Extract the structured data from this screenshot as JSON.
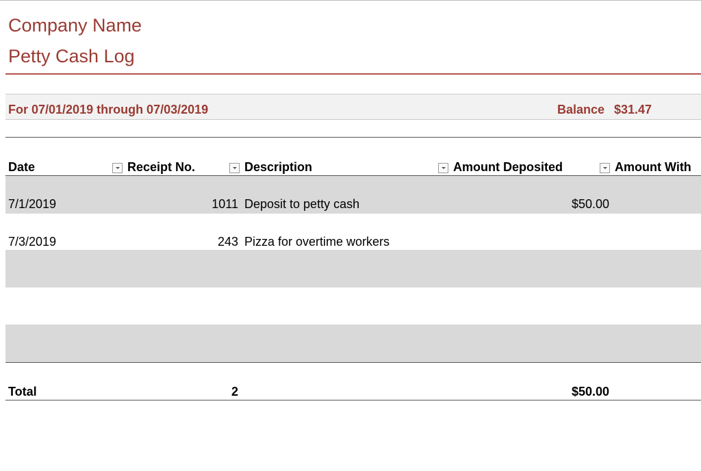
{
  "header": {
    "company_name": "Company Name",
    "log_title": "Petty Cash Log"
  },
  "period": {
    "text": "For 07/01/2019 through 07/03/2019",
    "balance_label": "Balance",
    "balance_value": "$31.47"
  },
  "columns": [
    {
      "label": "Date"
    },
    {
      "label": "Receipt No."
    },
    {
      "label": "Description"
    },
    {
      "label": "Amount Deposited"
    },
    {
      "label": "Amount With"
    }
  ],
  "rows": [
    {
      "date": "7/1/2019",
      "receipt": "1011",
      "description": "Deposit to petty cash",
      "deposited": "$50.00"
    },
    {
      "date": "7/3/2019",
      "receipt": "243",
      "description": "Pizza for overtime workers",
      "deposited": ""
    },
    {
      "date": "",
      "receipt": "",
      "description": "",
      "deposited": ""
    },
    {
      "date": "",
      "receipt": "",
      "description": "",
      "deposited": ""
    },
    {
      "date": "",
      "receipt": "",
      "description": "",
      "deposited": ""
    }
  ],
  "totals": {
    "label": "Total",
    "receipt_count": "2",
    "deposited": "$50.00"
  },
  "colors": {
    "accent": "#9a3b33",
    "band_shade": "#d9d9d9"
  },
  "icons": {
    "filter": "dropdown-arrow-icon"
  }
}
